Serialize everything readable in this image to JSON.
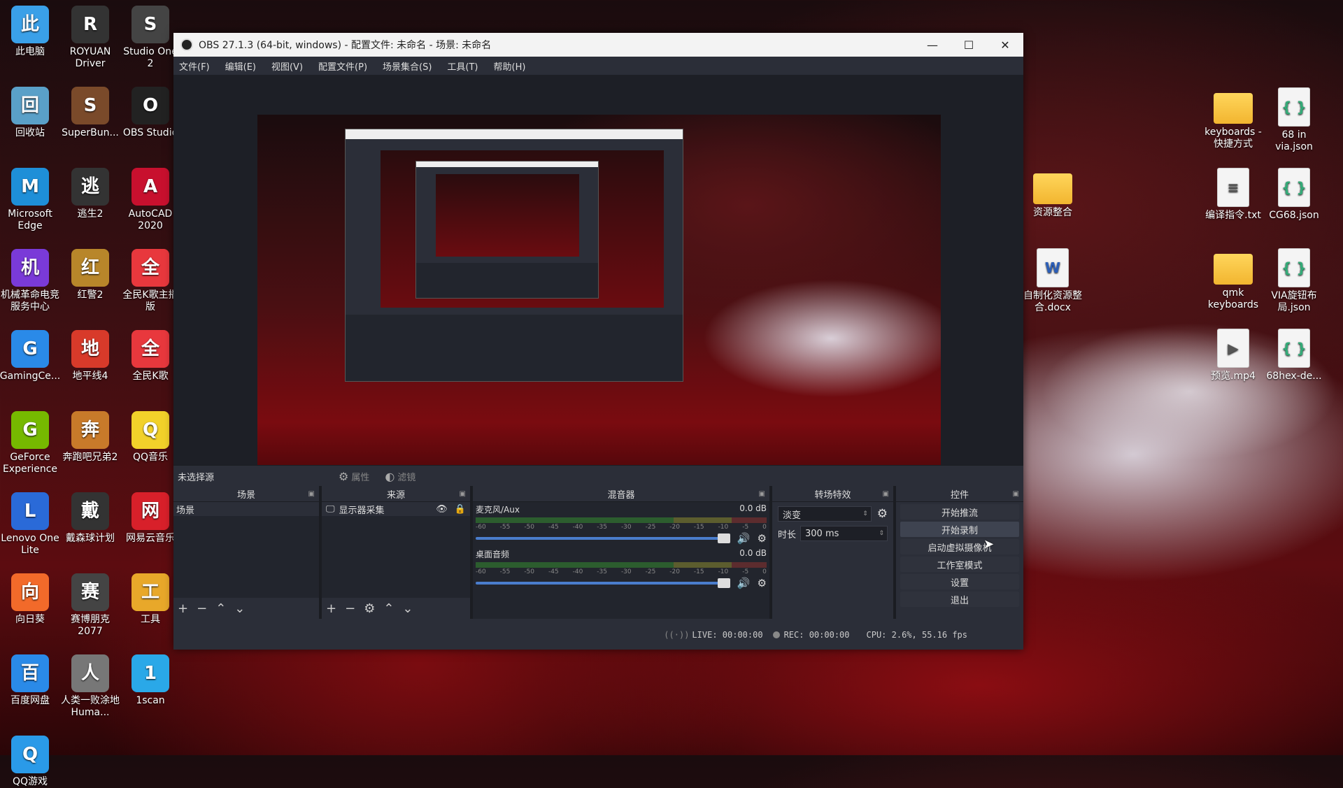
{
  "desktop": {
    "left_icons": [
      {
        "label": "此电脑",
        "icon": "monitor-icon",
        "color": "#3aa0e8"
      },
      {
        "label": "ROYUAN Driver",
        "icon": "royuan-driver-icon",
        "color": "#333333"
      },
      {
        "label": "Studio One 2",
        "icon": "studio-one-icon",
        "color": "#444444"
      },
      {
        "label": "回收站",
        "icon": "recycle-bin-icon",
        "color": "#5aa0c8"
      },
      {
        "label": "SuperBun...",
        "icon": "superbunnyman-icon",
        "color": "#7a4a2a"
      },
      {
        "label": "OBS Studio",
        "icon": "obs-icon",
        "color": "#222222"
      },
      {
        "label": "Microsoft Edge",
        "icon": "edge-icon",
        "color": "#1e8fd8"
      },
      {
        "label": "逃生2",
        "icon": "outlast-icon",
        "color": "#333333"
      },
      {
        "label": "AutoCAD 2020",
        "icon": "autocad-icon",
        "color": "#c8102e"
      },
      {
        "label": "机械革命电竞服务中心",
        "icon": "mechrevo-icon",
        "color": "#7a3ad8"
      },
      {
        "label": "红警2",
        "icon": "red-alert-icon",
        "color": "#b8862a"
      },
      {
        "label": "全民K歌主播版",
        "icon": "kge-host-icon",
        "color": "#e8383d"
      },
      {
        "label": "GamingCe...",
        "icon": "gaming-center-icon",
        "color": "#2a8ae8"
      },
      {
        "label": "地平线4",
        "icon": "forza-icon",
        "color": "#d83a2a"
      },
      {
        "label": "全民K歌",
        "icon": "kge-icon",
        "color": "#e8383d"
      },
      {
        "label": "GeForce Experience",
        "icon": "geforce-icon",
        "color": "#76b900"
      },
      {
        "label": "奔跑吧兄弟2",
        "icon": "game-icon",
        "color": "#c87a2a"
      },
      {
        "label": "QQ音乐",
        "icon": "qq-music-icon",
        "color": "#f2d12a"
      },
      {
        "label": "Lenovo One Lite",
        "icon": "lenovo-one-icon",
        "color": "#2a6ad8"
      },
      {
        "label": "戴森球计划",
        "icon": "dyson-sphere-icon",
        "color": "#333333"
      },
      {
        "label": "网易云音乐",
        "icon": "netease-music-icon",
        "color": "#d8202a"
      },
      {
        "label": "向日葵",
        "icon": "sunlogin-icon",
        "color": "#f26a2a"
      },
      {
        "label": "赛博朋克 2077",
        "icon": "cyberpunk-icon",
        "color": "#444444"
      },
      {
        "label": "工具",
        "icon": "tools-icon",
        "color": "#e8a82a"
      },
      {
        "label": "百度网盘",
        "icon": "baidu-pan-icon",
        "color": "#2a8ae8"
      },
      {
        "label": "人类一败涂地 Huma...",
        "icon": "human-fall-flat-icon",
        "color": "#777777"
      },
      {
        "label": "1scan",
        "icon": "1scan-icon",
        "color": "#2aa8e8"
      },
      {
        "label": "QQ游戏",
        "icon": "qq-game-icon",
        "color": "#2a9ae8"
      }
    ],
    "right_icons": [
      {
        "label": "keyboards - 快捷方式",
        "kind": "folder"
      },
      {
        "label": "68 in via.json",
        "kind": "json"
      },
      {
        "label": "资源整合",
        "kind": "folder"
      },
      {
        "label": "编译指令.txt",
        "kind": "txt"
      },
      {
        "label": "CG68.json",
        "kind": "json"
      },
      {
        "label": "自制化资源整合.docx",
        "kind": "docx"
      },
      {
        "label": "qmk keyboards",
        "kind": "folder"
      },
      {
        "label": "VIA旋钮布局.json",
        "kind": "json"
      },
      {
        "label": "预览.mp4",
        "kind": "mp4"
      },
      {
        "label": "68hex-de...",
        "kind": "json"
      }
    ]
  },
  "obs": {
    "title": "OBS 27.1.3 (64-bit, windows) - 配置文件: 未命名 - 场景: 未命名",
    "window_controls": {
      "minimize": "—",
      "maximize": "☐",
      "close": "✕"
    },
    "menu": [
      "文件(F)",
      "编辑(E)",
      "视图(V)",
      "配置文件(P)",
      "场景集合(S)",
      "工具(T)",
      "帮助(H)"
    ],
    "source_toolbar": {
      "no_selection": "未选择源",
      "properties": "属性",
      "filters": "滤镜"
    },
    "docks": {
      "scenes": {
        "title": "场景",
        "items": [
          "场景"
        ]
      },
      "sources": {
        "title": "来源",
        "items": [
          "显示器采集"
        ]
      },
      "mixer": {
        "title": "混音器",
        "ticks": [
          "-60",
          "-55",
          "-50",
          "-45",
          "-40",
          "-35",
          "-30",
          "-25",
          "-20",
          "-15",
          "-10",
          "-5",
          "0"
        ],
        "channels": [
          {
            "name": "麦克风/Aux",
            "db": "0.0 dB",
            "level": 1.0
          },
          {
            "name": "桌面音频",
            "db": "0.0 dB",
            "level": 1.0
          }
        ]
      },
      "transitions": {
        "title": "转场特效",
        "transition": "淡变",
        "duration_label": "时长",
        "duration_value": "300 ms"
      },
      "controls": {
        "title": "控件",
        "buttons": [
          "开始推流",
          "开始录制",
          "启动虚拟摄像机",
          "工作室模式",
          "设置",
          "退出"
        ]
      }
    },
    "status": {
      "live": "LIVE: 00:00:00",
      "rec": "REC: 00:00:00",
      "cpu": "CPU: 2.6%, 55.16 fps"
    }
  },
  "colors": {
    "obs_bg": "#2b2e38",
    "dock_bg": "#22252d",
    "accent_fader": "#4a7dcc"
  }
}
